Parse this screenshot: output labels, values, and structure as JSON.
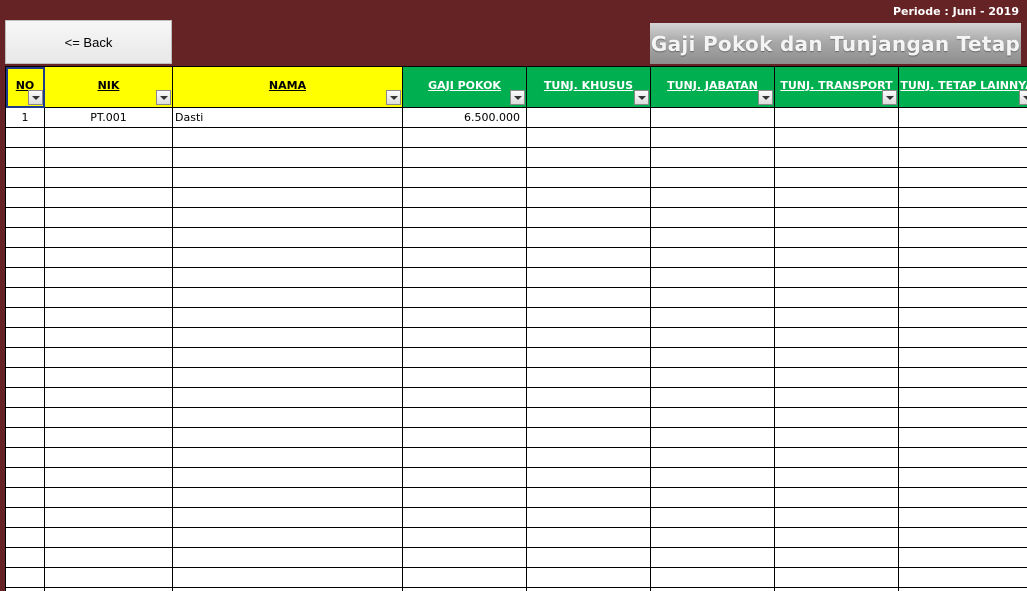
{
  "periode": "Periode : Juni - 2019",
  "back_label": "<= Back",
  "title": "Gaji Pokok dan Tunjangan Tetap",
  "headers": [
    "NO",
    "NIK",
    "NAMA",
    "GAJI POKOK",
    "TUNJ. KHUSUS",
    "TUNJ. JABATAN",
    "TUNJ. TRANSPORT",
    "TUNJ. TETAP LAINNYA"
  ],
  "rows": [
    {
      "no": "1",
      "nik": "PT.001",
      "nama": "Dasti",
      "gaji_pokok": "6.500.000",
      "tunj_khusus": "",
      "tunj_jabatan": "",
      "tunj_transport": "",
      "tunj_lainnya": ""
    }
  ],
  "colors": {
    "background": "#652325",
    "header_yellow": "#ffff00",
    "header_green": "#00b050"
  },
  "icons": {
    "filter": "dropdown-arrow-icon"
  }
}
